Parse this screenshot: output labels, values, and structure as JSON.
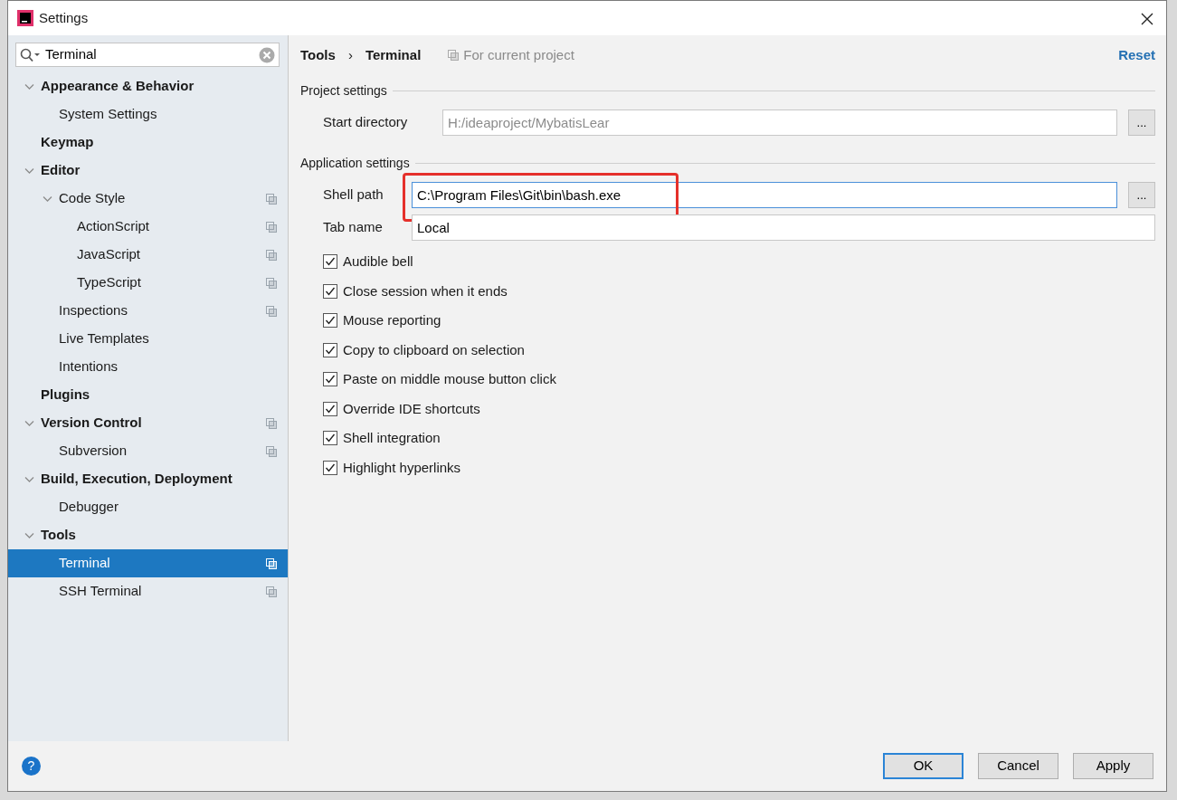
{
  "window": {
    "title": "Settings"
  },
  "search": {
    "value": "Terminal"
  },
  "tree": [
    {
      "label": "Appearance & Behavior",
      "selected": false,
      "project_icon": false,
      "expanded": true,
      "children": [
        {
          "label": "System Settings",
          "selected": false,
          "project_icon": false
        }
      ]
    },
    {
      "label": "Keymap",
      "selected": false,
      "project_icon": false
    },
    {
      "label": "Editor",
      "selected": false,
      "project_icon": false,
      "expanded": true,
      "children": [
        {
          "label": "Code Style",
          "selected": false,
          "project_icon": true,
          "expanded": true,
          "children": [
            {
              "label": "ActionScript",
              "selected": false,
              "project_icon": true
            },
            {
              "label": "JavaScript",
              "selected": false,
              "project_icon": true
            },
            {
              "label": "TypeScript",
              "selected": false,
              "project_icon": true
            }
          ]
        },
        {
          "label": "Inspections",
          "selected": false,
          "project_icon": true
        },
        {
          "label": "Live Templates",
          "selected": false,
          "project_icon": false
        },
        {
          "label": "Intentions",
          "selected": false,
          "project_icon": false
        }
      ]
    },
    {
      "label": "Plugins",
      "selected": false,
      "project_icon": false
    },
    {
      "label": "Version Control",
      "selected": false,
      "project_icon": true,
      "expanded": true,
      "children": [
        {
          "label": "Subversion",
          "selected": false,
          "project_icon": true
        }
      ]
    },
    {
      "label": "Build, Execution, Deployment",
      "selected": false,
      "project_icon": false,
      "expanded": true,
      "children": [
        {
          "label": "Debugger",
          "selected": false,
          "project_icon": false
        }
      ]
    },
    {
      "label": "Tools",
      "selected": false,
      "project_icon": false,
      "expanded": true,
      "children": [
        {
          "label": "Terminal",
          "selected": true,
          "project_icon": true
        },
        {
          "label": "SSH Terminal",
          "selected": false,
          "project_icon": true
        }
      ]
    }
  ],
  "header": {
    "breadcrumb": [
      "Tools",
      "Terminal"
    ],
    "separator": "›",
    "scope": "For current project",
    "reset": "Reset"
  },
  "sections": [
    {
      "title": "Project settings",
      "fields": [
        {
          "label": "Start directory",
          "value": "H:/ideaproject/MybatisLear",
          "disabled": true,
          "focused": false,
          "highlighted": false,
          "browse": "..."
        }
      ]
    },
    {
      "title": "Application settings",
      "fields": [
        {
          "label": "Shell path",
          "value": "C:\\Program Files\\Git\\bin\\bash.exe",
          "disabled": false,
          "focused": true,
          "highlighted": true,
          "browse": "..."
        },
        {
          "label": "Tab name",
          "value": "Local",
          "disabled": false,
          "focused": false,
          "highlighted": false
        }
      ]
    }
  ],
  "checkboxes": [
    {
      "label": "Audible bell",
      "checked": true
    },
    {
      "label": "Close session when it ends",
      "checked": true
    },
    {
      "label": "Mouse reporting",
      "checked": true
    },
    {
      "label": "Copy to clipboard on selection",
      "checked": true
    },
    {
      "label": "Paste on middle mouse button click",
      "checked": true
    },
    {
      "label": "Override IDE shortcuts",
      "checked": true
    },
    {
      "label": "Shell integration",
      "checked": true
    },
    {
      "label": "Highlight hyperlinks",
      "checked": true
    }
  ],
  "footer": {
    "help": "?",
    "buttons": [
      {
        "label": "OK",
        "default": true
      },
      {
        "label": "Cancel",
        "default": false
      },
      {
        "label": "Apply",
        "default": false
      }
    ]
  }
}
